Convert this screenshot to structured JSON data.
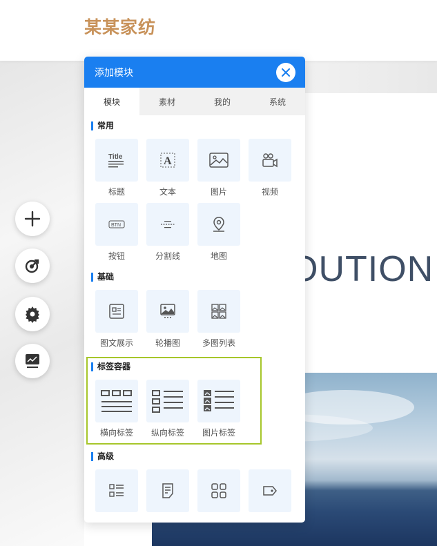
{
  "site": {
    "brand": "某某家纺",
    "hero_text": "OUTION"
  },
  "toolbar": [
    {
      "icon": "plus-icon"
    },
    {
      "icon": "target-icon"
    },
    {
      "icon": "gear-icon"
    },
    {
      "icon": "monitor-chart-icon"
    }
  ],
  "panel": {
    "title": "添加模块",
    "close_icon": "close-icon",
    "accent": "#1a7ff0",
    "highlight_color": "#a6c62a",
    "tabs": [
      "模块",
      "素材",
      "我的",
      "系统"
    ],
    "active_tab": "模块",
    "sections": [
      {
        "title": "常用",
        "items": [
          {
            "label": "标题",
            "icon": "title-icon"
          },
          {
            "label": "文本",
            "icon": "text-icon"
          },
          {
            "label": "图片",
            "icon": "image-icon"
          },
          {
            "label": "视频",
            "icon": "video-icon"
          },
          {
            "label": "按钮",
            "icon": "button-icon"
          },
          {
            "label": "分割线",
            "icon": "divider-icon"
          },
          {
            "label": "地图",
            "icon": "map-pin-icon"
          }
        ]
      },
      {
        "title": "基础",
        "items": [
          {
            "label": "图文展示",
            "icon": "image-text-icon"
          },
          {
            "label": "轮播图",
            "icon": "carousel-icon"
          },
          {
            "label": "多图列表",
            "icon": "multi-image-list-icon"
          }
        ]
      },
      {
        "title": "标签容器",
        "highlighted": true,
        "items": [
          {
            "label": "横向标签",
            "icon": "horizontal-tabs-icon"
          },
          {
            "label": "纵向标签",
            "icon": "vertical-tabs-icon"
          },
          {
            "label": "图片标签",
            "icon": "image-tabs-icon"
          }
        ]
      },
      {
        "title": "高级",
        "items": [
          {
            "label": "",
            "icon": "list-icon"
          },
          {
            "label": "",
            "icon": "form-icon"
          },
          {
            "label": "",
            "icon": "apps-grid-icon"
          },
          {
            "label": "",
            "icon": "tag-icon"
          }
        ]
      }
    ]
  }
}
